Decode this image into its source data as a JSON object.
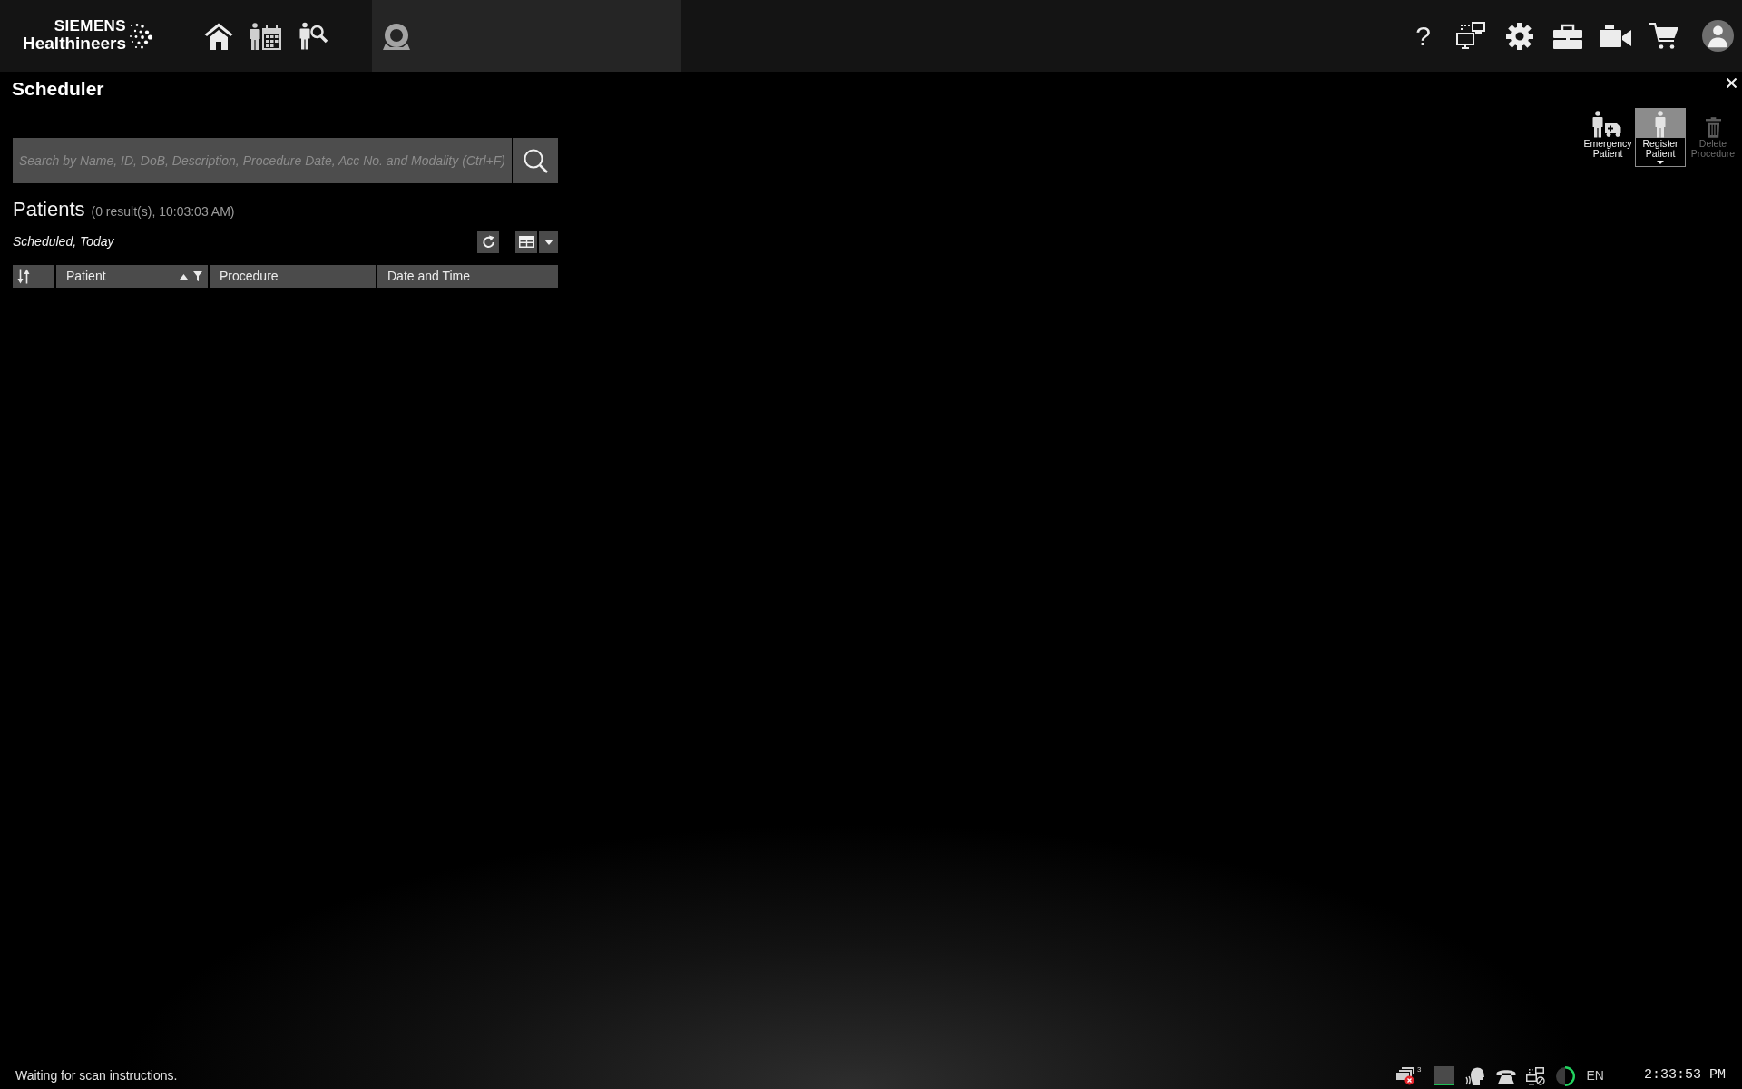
{
  "top_bar": {
    "logo": {
      "brand": "SIEMENS",
      "name": "Healthineers"
    },
    "help_label": "?"
  },
  "panel": {
    "title": "Scheduler"
  },
  "toolbar": {
    "buttons": [
      {
        "label": "Emergency Patient",
        "highlighted": false,
        "disabled": false,
        "dropdown": false
      },
      {
        "label": "Register Patient",
        "highlighted": true,
        "disabled": false,
        "dropdown": true
      },
      {
        "label": "Delete Procedure",
        "highlighted": false,
        "disabled": true,
        "dropdown": false
      }
    ]
  },
  "search": {
    "placeholder": "Search by Name, ID, DoB, Description, Procedure Date, Acc No. and Modality (Ctrl+F)"
  },
  "patients": {
    "title": "Patients",
    "summary": "(0 result(s), 10:03:03 AM)",
    "filter": "Scheduled, Today"
  },
  "table": {
    "columns": [
      {
        "kind": "sort_toggle"
      },
      {
        "kind": "text",
        "label": "Patient",
        "sorted": true,
        "filter": true
      },
      {
        "kind": "text",
        "label": "Procedure",
        "sorted": false,
        "filter": false
      },
      {
        "kind": "text",
        "label": "Date and Time",
        "sorted": false,
        "filter": false
      }
    ]
  },
  "status_bar": {
    "message": "Waiting for scan instructions.",
    "alert_count": "3",
    "language": "EN",
    "time": "2:33:53 PM"
  }
}
